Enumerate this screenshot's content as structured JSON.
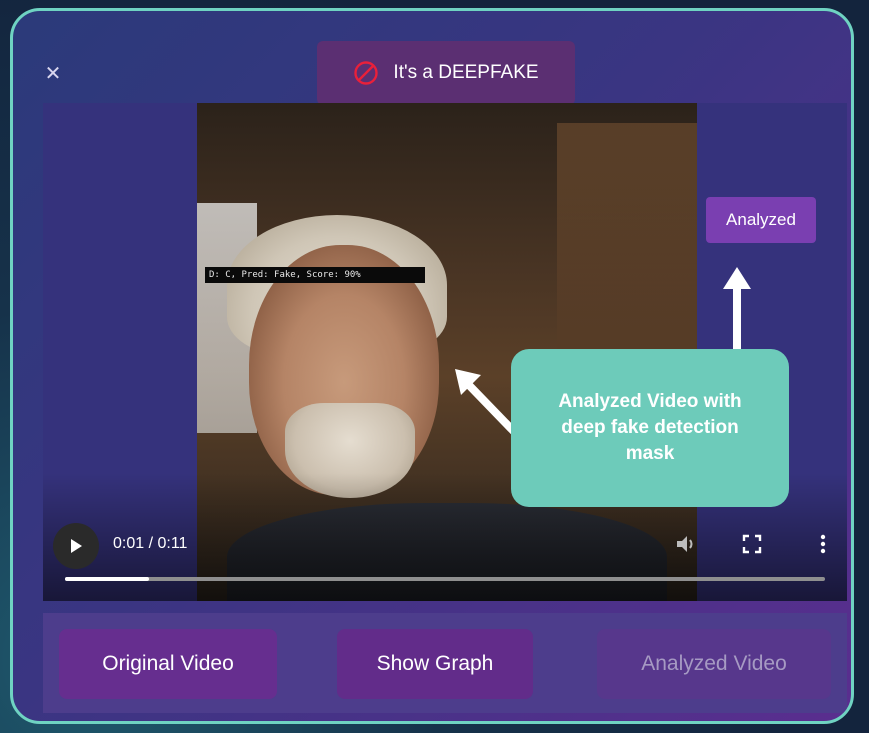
{
  "close_icon": "close-icon",
  "verdict": {
    "icon": "prohibited-icon",
    "text": "It's a DEEPFAKE",
    "icon_color": "#e9203a"
  },
  "video": {
    "detection_label": "D: C, Pred: Fake, Score: 90%",
    "time": "0:01 / 0:11",
    "progress": 0.11,
    "controls": [
      "play-icon",
      "volume-icon",
      "fullscreen-icon",
      "more-vert-icon"
    ]
  },
  "annotations": {
    "analyzed_tag": "Analyzed",
    "callout": "Analyzed Video with deep fake detection mask",
    "callout_color": "#6dcbba"
  },
  "buttons": {
    "original": "Original Video",
    "graph": "Show Graph",
    "analyzed": "Analyzed Video"
  },
  "colors": {
    "border": "#6fd3c2",
    "accent": "#662e8f"
  }
}
